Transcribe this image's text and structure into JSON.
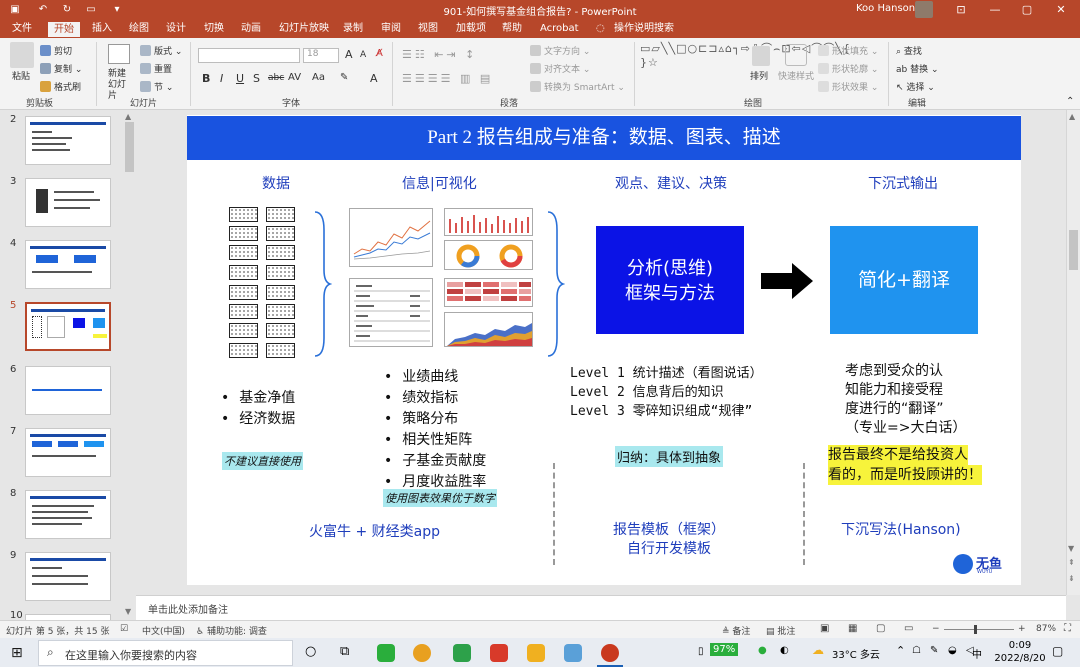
{
  "window": {
    "title": "901-如何撰写基金组合报告? - PowerPoint",
    "user": "Koo Hanson",
    "minimize_icon": "—",
    "restore_icon": "▢",
    "close_icon": "✕"
  },
  "menu": [
    "文件",
    "开始",
    "插入",
    "绘图",
    "设计",
    "切换",
    "动画",
    "幻灯片放映",
    "录制",
    "审阅",
    "视图",
    "加载项",
    "帮助",
    "Acrobat",
    "操作说明搜索"
  ],
  "ribbon": {
    "clipboard": {
      "paste": "粘贴",
      "cut": "剪切",
      "copy": "复制",
      "format_painter": "格式刷",
      "label": "剪贴板"
    },
    "slides": {
      "new_slide": "新建幻灯片",
      "layout": "版式",
      "reset": "重置",
      "section": "节",
      "label": "幻灯片"
    },
    "font": {
      "size": "18",
      "bold": "B",
      "italic": "I",
      "underline": "U",
      "strike": "S",
      "shadow": "abc",
      "spacing": "AV",
      "case": "Aa",
      "grow": "A",
      "shrink": "A",
      "color": "A",
      "label": "字体"
    },
    "paragraph": {
      "text_direction": "文字方向",
      "align_text": "对齐文本",
      "smartart": "转换为 SmartArt",
      "label": "段落"
    },
    "drawing": {
      "arrange": "排列",
      "quick_styles": "快速样式",
      "fill": "形状填充",
      "outline": "形状轮廓",
      "effects": "形状效果",
      "label": "绘图",
      "shapes": "▭▱╲╲□○⊏⊐▵⌂┐⇨⇩⌒⌢⊡⇦◁⌒⌒╲{ }☆"
    },
    "editing": {
      "find": "查找",
      "replace": "替换",
      "select": "选择",
      "label": "编辑"
    }
  },
  "thumbnails": {
    "numbers": [
      "2",
      "3",
      "4",
      "5",
      "6",
      "7",
      "8",
      "9",
      "10"
    ],
    "selected": "5"
  },
  "slide": {
    "title": "Part 2 报告组成与准备：数据、图表、描述",
    "headers": [
      "数据",
      "信息|可视化",
      "观点、建议、决策",
      "下沉式输出"
    ],
    "data_bullets": [
      "基金净值",
      "经济数据"
    ],
    "data_note": "不建议直接使用",
    "viz_bullets": [
      "业绩曲线",
      "绩效指标",
      "策略分布",
      "相关性矩阵",
      "子基金贡献度",
      "月度收益胜率"
    ],
    "viz_note": "使用图表效果优于数字",
    "box_analysis": [
      "分析(思维)",
      "框架与方法"
    ],
    "box_simplify": "简化+翻译",
    "levels": [
      "Level 1 统计描述（看图说话）",
      "Level 2 信息背后的知识",
      "Level 3 零碎知识组成“规律”"
    ],
    "levels_note": "归纳：具体到抽象",
    "audience_text": [
      "考虑到受众的认",
      "知能力和接受程",
      "度进行的“翻译”",
      "（专业=>大白话）"
    ],
    "highlight": [
      "报告最终不是给投资人",
      "看的，而是听投顾讲的！"
    ],
    "bottom_data": "火富牛 + 财经类app",
    "bottom_template": [
      "报告模板（框架）",
      "自行开发模板"
    ],
    "bottom_hanson": "下沉写法(Hanson)",
    "logo_text": "无鱼",
    "logo_sub": "WUYU"
  },
  "notes_placeholder": "单击此处添加备注",
  "status": {
    "slide_info": "幻灯片 第 5 张，共 15 张",
    "language": "中文(中国)",
    "accessibility": "辅助功能: 调查",
    "notes": "备注",
    "comments": "批注",
    "zoom": "87%"
  },
  "taskbar": {
    "search_placeholder": "在这里输入你要搜索的内容",
    "battery": "97%",
    "weather": "33°C 多云",
    "time": "0:09",
    "date": "2022/8/20",
    "ime": "中"
  },
  "colors": {
    "accent": "#b7472a",
    "title_blue": "#1953e0",
    "box_blue": "#0b13e6",
    "box_sky": "#1f93ef",
    "highlight": "#f7f33b",
    "cyan_note": "#a9e8ee"
  }
}
